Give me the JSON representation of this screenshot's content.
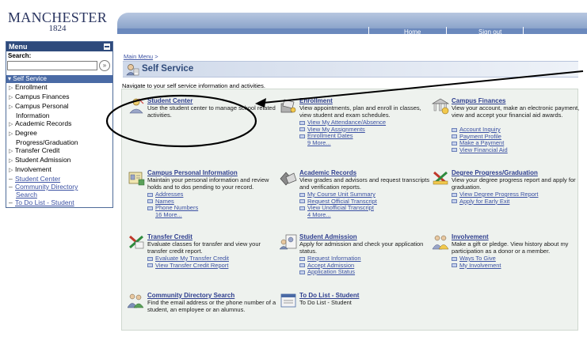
{
  "header": {
    "logo_name": "MANCHESTER",
    "logo_year": "1824",
    "home_link": "Home",
    "signout_link": "Sign out"
  },
  "menu": {
    "title": "Menu",
    "search_label": "Search:",
    "search_value": "",
    "search_go": "»",
    "root_label": "Self Service",
    "items": [
      {
        "label": "Enrollment"
      },
      {
        "label": "Campus Finances"
      },
      {
        "label": "Campus Personal",
        "cont": "Information"
      },
      {
        "label": "Academic Records"
      },
      {
        "label": "Degree",
        "cont": "Progress/Graduation"
      },
      {
        "label": "Transfer Credit"
      },
      {
        "label": "Student Admission"
      },
      {
        "label": "Involvement"
      }
    ],
    "links": [
      {
        "label": "Student Center"
      },
      {
        "label": "Community Directory",
        "cont": "Search"
      },
      {
        "label": "To Do List - Student"
      }
    ]
  },
  "main": {
    "breadcrumb": "Main Menu",
    "breadcrumb_sep": ">",
    "title": "Self Service",
    "intro": "Navigate to your self service information and activities.",
    "tiles": [
      {
        "id": "student-center",
        "title": "Student Center",
        "desc": "Use the student center to manage school related activities.",
        "links": []
      },
      {
        "id": "enrollment",
        "title": "Enrollment",
        "desc": "View appointments, plan and enroll in classes, view student and exam schedules.",
        "links": [
          "View My Attendance/Absence",
          "View My Assignments",
          "Enrollment Dates"
        ],
        "more": "9 More..."
      },
      {
        "id": "campus-finances",
        "title": "Campus Finances",
        "desc": "View your account, make an electronic payment, view and accept your financial aid awards.",
        "links": [
          "Account Inquiry",
          "Payment Profile",
          "Make a Payment",
          "View Financial Aid"
        ]
      },
      {
        "id": "campus-personal",
        "title": "Campus Personal Information",
        "desc": "Maintain your personal information and review holds and to dos pending to your record.",
        "links": [
          "Addresses",
          "Names",
          "Phone Numbers"
        ],
        "more": "16 More..."
      },
      {
        "id": "academic-records",
        "title": "Academic Records",
        "desc": "View grades and advisors and request transcripts and verification reports.",
        "links": [
          "My Course Unit Summary",
          "Request Official Transcript",
          "View Unofficial Transcript"
        ],
        "more": "4 More..."
      },
      {
        "id": "degree-progress",
        "title": "Degree Progress/Graduation",
        "desc": "View your degree progress report and apply for graduation.",
        "links": [
          "View Degree Progress Report",
          "Apply for Early Exit"
        ]
      },
      {
        "id": "transfer-credit",
        "title": "Transfer Credit",
        "desc": "Evaluate classes for transfer and view your transfer credit report.",
        "links": [
          "Evaluate My Transfer Credit",
          "View Transfer Credit Report"
        ]
      },
      {
        "id": "student-admission",
        "title": "Student Admission",
        "desc": "Apply for admission and check your application status.",
        "links": [
          "Request Information",
          "Accept Admission",
          "Application Status"
        ]
      },
      {
        "id": "involvement",
        "title": "Involvement",
        "desc": "Make a gift or pledge. View history about my participation as a donor or a member.",
        "links": [
          "Ways To Give",
          "My Involvement"
        ]
      },
      {
        "id": "community-directory",
        "title": "Community Directory Search",
        "desc": "Find the email address or the phone number of a student, an employee or an alumnus.",
        "links": []
      },
      {
        "id": "todo-list",
        "title": "To Do List - Student",
        "desc": "To Do List - Student",
        "links": []
      }
    ]
  },
  "colors": {
    "brand_blue": "#2e4a7c",
    "link_blue": "#3b51a3",
    "panel_bg": "#eef2ee",
    "header_blue": "#7e99c4",
    "annotation_black": "#000000"
  },
  "icons": [
    "student-center-icon",
    "enrollment-icon",
    "campus-finances-icon",
    "campus-personal-icon",
    "academic-records-icon",
    "degree-progress-icon",
    "transfer-credit-icon",
    "student-admission-icon",
    "involvement-icon",
    "community-directory-icon",
    "todo-list-icon",
    "self-service-icon",
    "search-go-icon",
    "collapse-icon",
    "link-bullet-icon"
  ]
}
